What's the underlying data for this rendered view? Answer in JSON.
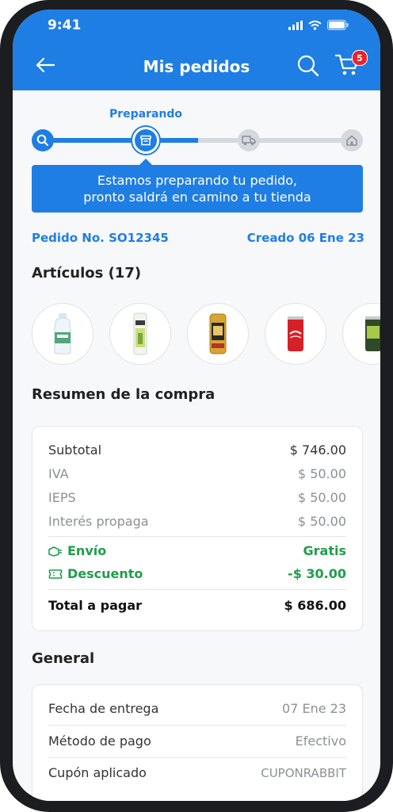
{
  "status_bar": {
    "time": "9:41"
  },
  "header": {
    "title": "Mis pedidos",
    "cart_count": "5"
  },
  "progress": {
    "current_step_label": "Preparando",
    "message_line1": "Estamos preparando tu pedido,",
    "message_line2": "pronto saldrá en camino a tu tienda"
  },
  "order": {
    "number": "Pedido No. SO12345",
    "created": "Creado 06 Ene 23"
  },
  "articles": {
    "title": "Artículos (17)"
  },
  "summary": {
    "title": "Resumen de la compra",
    "subtotal_label": "Subtotal",
    "subtotal_value": "$ 746.00",
    "iva_label": "IVA",
    "iva_value": "$ 50.00",
    "ieps_label": "IEPS",
    "ieps_value": "$ 50.00",
    "interest_label": "Interés propaga",
    "interest_value": "$ 50.00",
    "shipping_label": "Envío",
    "shipping_value": "Gratis",
    "discount_label": "Descuento",
    "discount_value": "-$ 30.00",
    "total_label": "Total a pagar",
    "total_value": "$ 686.00"
  },
  "general": {
    "title": "General",
    "delivery_label": "Fecha de entrega",
    "delivery_value": "07 Ene 23",
    "payment_label": "Método de pago",
    "payment_value": "Efectivo",
    "coupon_label": "Cupón aplicado",
    "coupon_value": "CUPONRABBIT"
  },
  "colors": {
    "primary": "#1f7ee3",
    "success": "#1f9e4a",
    "badge": "#e3262f"
  }
}
